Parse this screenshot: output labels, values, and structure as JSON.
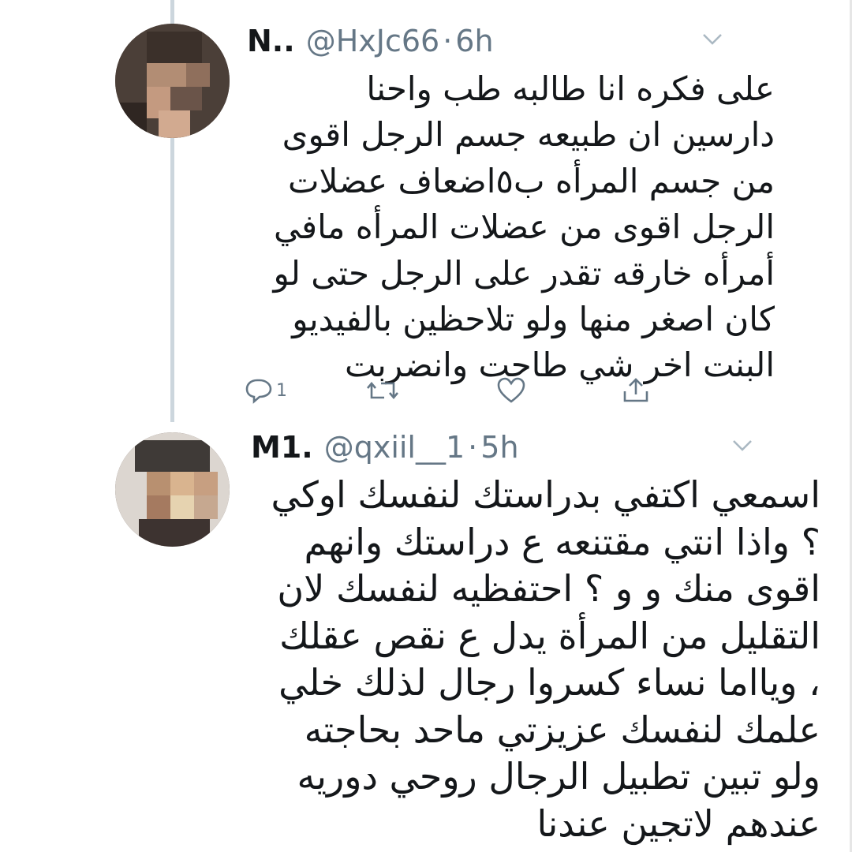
{
  "tweets": [
    {
      "name": "N..",
      "handle": "@HxJc66",
      "separator": "·",
      "time": "6h",
      "lines": [
        "على فكره انا طالبه طب واحنا",
        "دارسين ان طبيعه جسم الرجل اقوى",
        "من جسم المرأه ب٥اضعاف عضلات",
        "الرجل اقوى من عضلات المرأه مافي",
        "أمرأه خارقه تقدر على الرجل حتى لو",
        "كان اصغر منها ولو تلاحظين بالفيديو",
        "البنت اخر شي طاحت وانضربت"
      ],
      "reply_count": "1",
      "icons": {
        "reply": "reply-icon",
        "retweet": "retweet-icon",
        "like": "heart-icon",
        "share": "share-icon",
        "menu": "chevron-down-icon"
      }
    },
    {
      "name": "M1.",
      "handle": "@qxiil__1",
      "separator": "·",
      "time": "5h",
      "lines": [
        "اسمعي اكتفي بدراستك لنفسك اوكي",
        "؟ واذا انتي مقتنعه ع دراستك وانهم",
        "اقوى منك و و ؟ احتفظيه لنفسك لان",
        "التقليل من المرأة يدل ع نقص عقلك",
        "، ويااما نساء كسروا رجال لذلك خلي",
        "علمك لنفسك عزيزتي ماحد بحاجته",
        "ولو تبين تطبيل الرجال روحي دوريه",
        "عندهم لاتجين عندنا"
      ],
      "icons": {
        "menu": "chevron-down-icon"
      }
    }
  ],
  "colors": {
    "text": "#14171a",
    "secondary": "#657786",
    "thread": "#ccd6dd"
  }
}
